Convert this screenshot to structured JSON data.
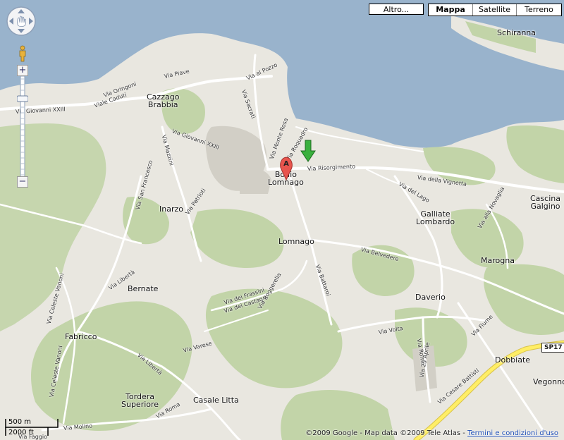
{
  "map_type": {
    "more_label": "Altro...",
    "options": [
      {
        "label": "Mappa",
        "active": true
      },
      {
        "label": "Satellite",
        "active": false
      },
      {
        "label": "Terreno",
        "active": false
      }
    ]
  },
  "zoom": {
    "plus": "+",
    "minus": "−",
    "level_fraction": 0.2
  },
  "towns": {
    "schiranna": "Schiranna",
    "cazzago": "Cazzago\nBrabbia",
    "bodio": "Bodio\nLomnago",
    "cascina": "Cascina\nGalgino",
    "galliate": "Galliate\nLombardo",
    "inarzo": "Inarzo",
    "lomnago": "Lomnago",
    "marogna": "Marogna",
    "bernate": "Bernate",
    "daverio": "Daverio",
    "fabricco": "Fabricco",
    "dobbiate": "Dobbiate",
    "vegonno": "Vegonno",
    "tordera": "Tordera\nSuperiore",
    "casale": "Casale Litta"
  },
  "streets": {
    "via_piave": "Via Piave",
    "via_al_pozzo": "Via al Pozzo",
    "via_oringoni": "Via Oringoni",
    "viale_caduti": "Viale Caduti",
    "via_giovanni_xxiii_w": "Via Giovanni XXIII",
    "via_giovanni_xxiii": "Via Giovanni XXIII",
    "via_mazzini": "Via Mazzini",
    "via_sacrati": "Via Sacrati",
    "via_monte_rosa": "Via Monte Rosa",
    "via_roquadro": "Via Roquadro",
    "via_risorgimento": "Via Risorgimento",
    "via_della_vignetta": "Via della Vignetta",
    "via_del_lago": "Via del Lago",
    "via_alla_novaglia": "Via alla Novaglia",
    "via_san_francesco": "Via San Francesco",
    "via_patrioti": "Via Patrioti",
    "via_belvedere": "Via Belvedere",
    "via_battaroi": "Via Battaroi",
    "via_liberta_n": "Via Libertà",
    "via_celeste_vanoni_n": "Via Celeste Vanoni",
    "via_dei_frassini": "Via dei Frassini",
    "via_dei_castagni": "Via dei Castagni",
    "via_roggerella": "Via Roggerella",
    "via_volta": "Via Volta",
    "via_fiume": "Via Fiume",
    "via_roma_e": "Via Roma",
    "via_25_aprile": "Via 25 Aprile",
    "via_cesare_battisti": "Via Cesare Battisti",
    "via_varese": "Via Varese",
    "via_liberta_s": "Via Libertà",
    "via_celeste_vanoni_s": "Via Celeste Vanoni",
    "via_roma_s": "Via Roma",
    "via_molino": "Via Molino",
    "via_faggio": "Via Faggio"
  },
  "road_shield": "SP17",
  "markers": {
    "a_letter": "A"
  },
  "scale": {
    "metric": "500 m",
    "imperial": "2000 ft"
  },
  "copyright": {
    "text": "©2009 Google - Map data ©2009 Tele Atlas - ",
    "terms_link": "Termini e condizioni d'uso"
  },
  "colors": {
    "water": "#99b3cc",
    "land": "#e9e7e0",
    "park": "#c2d4a8",
    "urban": "#d9d6cc",
    "road": "#ffffff",
    "highway": "#ffee66",
    "marker_red": "#e8554e",
    "marker_green": "#3ab03e"
  }
}
